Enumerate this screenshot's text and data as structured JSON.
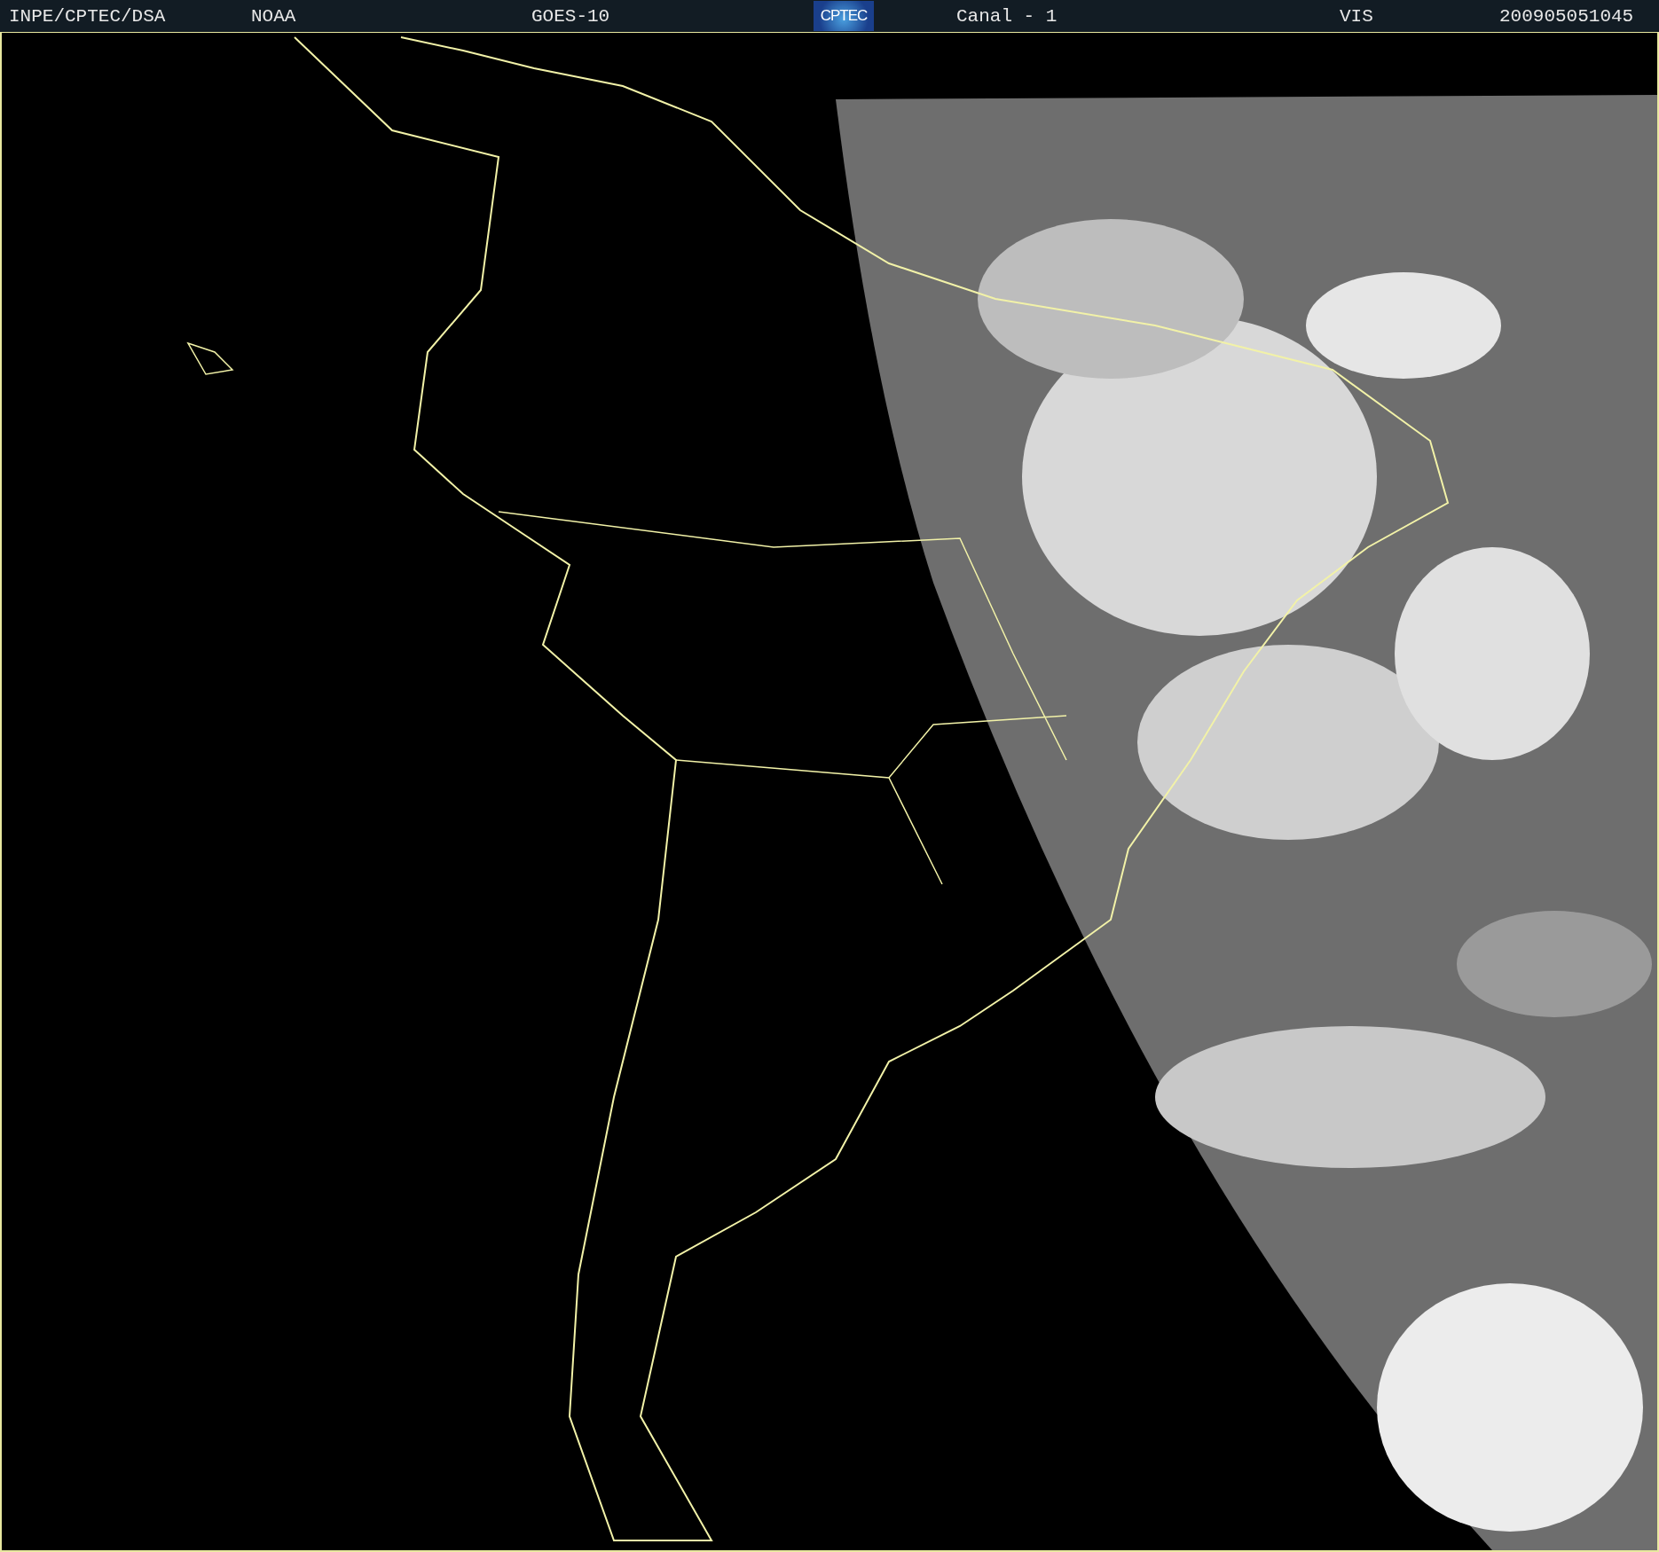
{
  "header": {
    "items": [
      {
        "kind": "text",
        "label": "INPE/CPTEC/DSA"
      },
      {
        "kind": "text",
        "label": "NOAA"
      },
      {
        "kind": "text",
        "label": "GOES-10"
      },
      {
        "kind": "logo",
        "label": "CPTEC"
      },
      {
        "kind": "text",
        "label": "Canal - 1"
      },
      {
        "kind": "text",
        "label": "VIS"
      },
      {
        "kind": "text",
        "label": "200905051045"
      }
    ]
  }
}
